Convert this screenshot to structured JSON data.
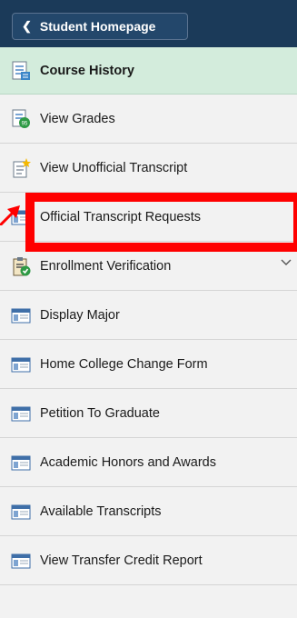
{
  "header": {
    "back_label": "Student Homepage",
    "back_icon": "chevron-left-icon"
  },
  "menu": {
    "items": [
      {
        "label": "Course History",
        "icon": "report-icon",
        "active": true
      },
      {
        "label": "View Grades",
        "icon": "grades-report-icon"
      },
      {
        "label": "View Unofficial Transcript",
        "icon": "new-document-icon"
      },
      {
        "label": "Official Transcript Requests",
        "icon": "window-icon"
      },
      {
        "label": "Enrollment Verification",
        "icon": "clipboard-check-icon",
        "expandable": true
      },
      {
        "label": "Display Major",
        "icon": "window-icon"
      },
      {
        "label": "Home College Change Form",
        "icon": "window-icon"
      },
      {
        "label": "Petition To Graduate",
        "icon": "window-icon"
      },
      {
        "label": "Academic Honors and Awards",
        "icon": "window-icon"
      },
      {
        "label": "Available Transcripts",
        "icon": "window-icon"
      },
      {
        "label": "View Transfer Credit Report",
        "icon": "window-icon"
      }
    ]
  },
  "annotation": {
    "highlight_color": "#ff0000"
  },
  "colors": {
    "header_bg": "#1b3a59",
    "active_bg": "#d3ecdc",
    "menu_bg": "#f2f2f2"
  }
}
